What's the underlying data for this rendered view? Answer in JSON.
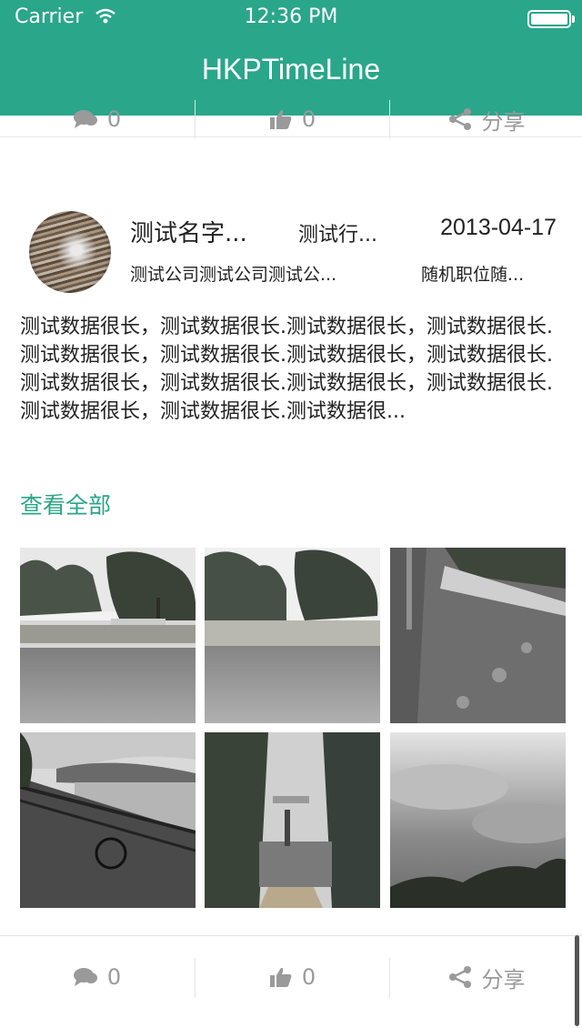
{
  "status_bar": {
    "carrier": "Carrier",
    "time": "12:36 PM"
  },
  "nav": {
    "title": "HKPTimeLine"
  },
  "top_actions": {
    "comment_count": "0",
    "like_count": "0",
    "share_label": "分享"
  },
  "post": {
    "name": "测试名字...",
    "industry": "测试行...",
    "date": "2013-04-17",
    "company": "测试公司测试公司测试公...",
    "position": "随机职位随...",
    "content": "测试数据很长，测试数据很长.测试数据很长，测试数据很长.测试数据很长，测试数据很长.测试数据很长，测试数据很长.测试数据很长，测试数据很长.测试数据很长，测试数据很长.测试数据很长，测试数据很长.测试数据很...",
    "view_all": "查看全部",
    "photos": [
      "park-plaza-photo",
      "park-plaza-photo",
      "shaded-path-photo",
      "lakeside-railing-photo",
      "lake-pier-photo",
      "cloudy-sky-photo"
    ]
  },
  "bottom_actions": {
    "comment_count": "0",
    "like_count": "0",
    "share_label": "分享"
  },
  "colors": {
    "accent": "#2aa68a",
    "icon_gray": "#9a9a9a"
  }
}
